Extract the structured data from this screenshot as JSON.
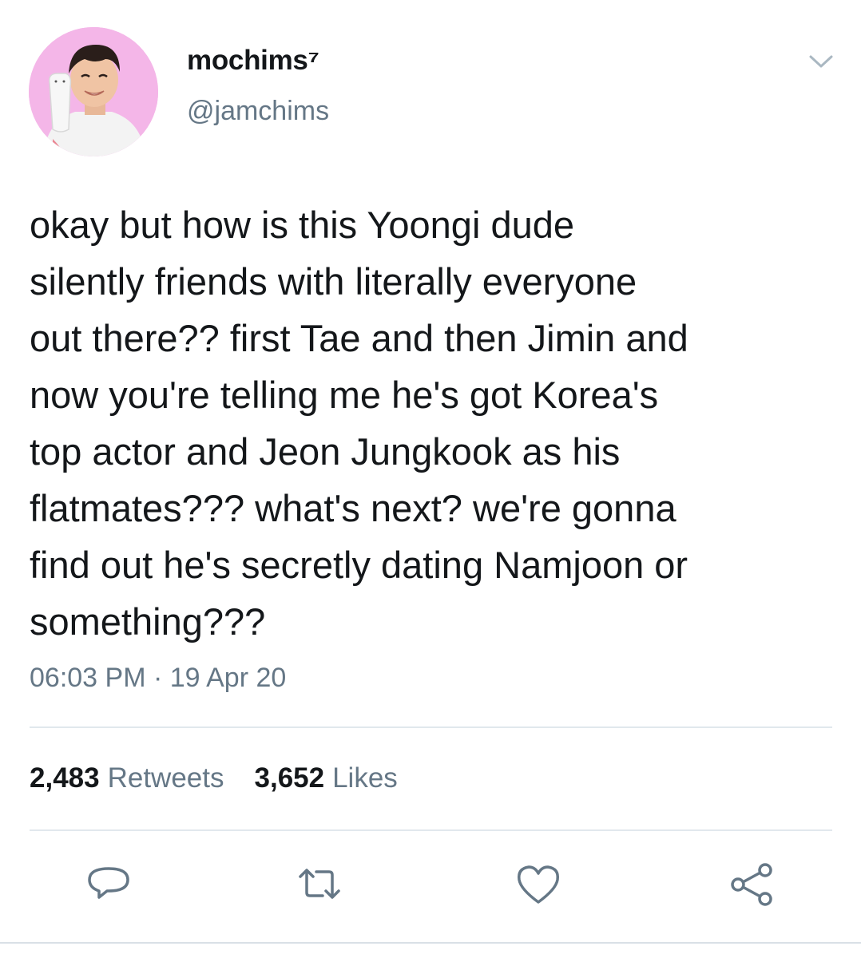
{
  "user": {
    "display_name": "mochims⁷",
    "handle": "@jamchims"
  },
  "tweet": {
    "text": "okay but how is this Yoongi dude\nsilently friends with literally everyone\nout there?? first Tae and then Jimin and\nnow you're telling me he's got Korea's\ntop actor and Jeon Jungkook as his\nflatmates??? what's next? we're gonna\nfind out he's secretly dating Namjoon or\nsomething???",
    "timestamp": "06:03 PM · 19 Apr 20"
  },
  "stats": {
    "retweets_count": "2,483",
    "retweets_label": "Retweets",
    "likes_count": "3,652",
    "likes_label": "Likes"
  },
  "icons": {
    "menu": "chevron-down-icon",
    "reply": "reply-icon",
    "retweet": "retweet-icon",
    "like": "heart-icon",
    "share": "share-icon"
  },
  "colors": {
    "text": "#14171a",
    "secondary": "#657786",
    "divider": "#e1e8ed",
    "avatar_bg": "#f2b8e6"
  }
}
